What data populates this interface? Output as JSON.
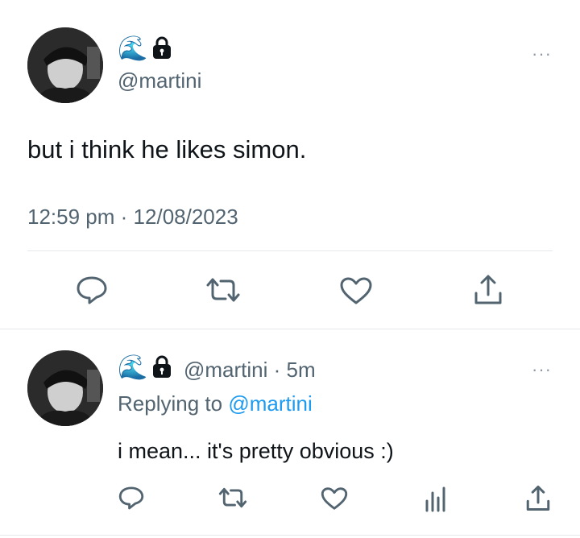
{
  "main_tweet": {
    "emoji": "🌊",
    "handle": "@martini",
    "text": "but i think he likes simon.",
    "time": "12:59 pm",
    "date": "12/08/2023",
    "separator": "·",
    "more": "···"
  },
  "reply_tweet": {
    "emoji": "🌊",
    "handle": "@martini",
    "dot": "·",
    "age": "5m",
    "replying_prefix": "Replying to",
    "replying_handle": "@martini",
    "text": "i mean... it's pretty obvious :)",
    "more": "···"
  },
  "icons": {
    "reply": "reply-icon",
    "retweet": "retweet-icon",
    "like": "like-icon",
    "share": "share-icon",
    "analytics": "analytics-icon",
    "lock": "lock-icon"
  },
  "colors": {
    "accent": "#1d9bf0",
    "icon": "#536471",
    "text": "#0f1419"
  }
}
